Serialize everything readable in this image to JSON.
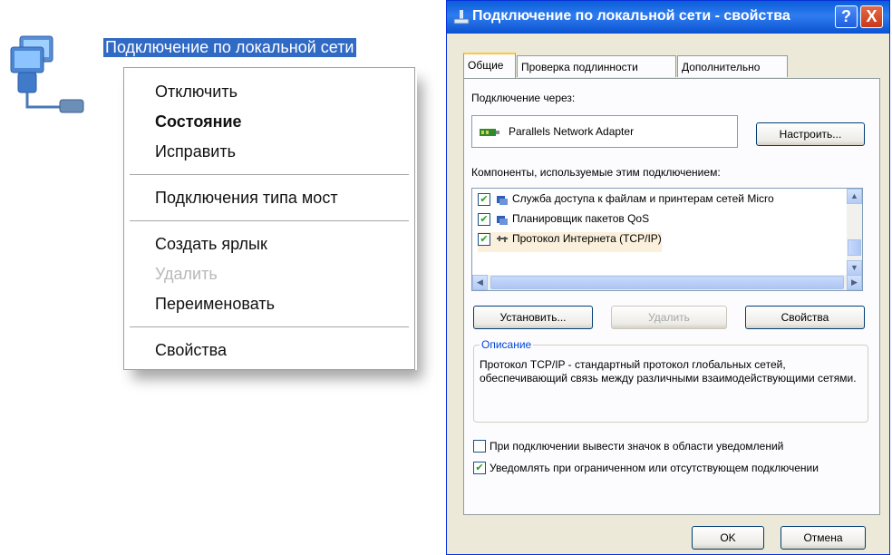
{
  "desktop": {
    "icon_label": "Подключение по локальной сети"
  },
  "context_menu": {
    "items": [
      {
        "label": "Отключить",
        "bold": false,
        "disabled": false
      },
      {
        "label": "Состояние",
        "bold": true,
        "disabled": false
      },
      {
        "label": "Исправить",
        "bold": false,
        "disabled": false
      },
      {
        "label": "Подключения типа мост",
        "bold": false,
        "disabled": false
      },
      {
        "label": "Создать ярлык",
        "bold": false,
        "disabled": false
      },
      {
        "label": "Удалить",
        "bold": false,
        "disabled": true
      },
      {
        "label": "Переименовать",
        "bold": false,
        "disabled": false
      },
      {
        "label": "Свойства",
        "bold": false,
        "disabled": false
      }
    ]
  },
  "dialog": {
    "title": "Подключение по локальной сети - свойства",
    "help_label": "?",
    "close_label": "X",
    "tabs": [
      {
        "label": "Общие",
        "active": true
      },
      {
        "label": "Проверка подлинности",
        "active": false
      },
      {
        "label": "Дополнительно",
        "active": false
      }
    ],
    "connect_using_label": "Подключение через:",
    "adapter_name": "Parallels Network Adapter",
    "configure_button": "Настроить...",
    "components_label": "Компоненты, используемые этим подключением:",
    "components": [
      {
        "label": "Служба доступа к файлам и принтерам сетей Micro",
        "checked": true,
        "selected": false,
        "icon": "service-icon"
      },
      {
        "label": "Планировщик пакетов QoS",
        "checked": true,
        "selected": false,
        "icon": "service-icon"
      },
      {
        "label": "Протокол Интернета (TCP/IP)",
        "checked": true,
        "selected": true,
        "icon": "protocol-icon"
      }
    ],
    "install_button": "Установить...",
    "remove_button": "Удалить",
    "properties_button": "Свойства",
    "description_title": "Описание",
    "description_text": "Протокол TCP/IP - стандартный протокол глобальных сетей, обеспечивающий связь между различными взаимодействующими сетями.",
    "show_icon_option": {
      "label": "При подключении вывести значок в области уведомлений",
      "checked": false
    },
    "notify_option": {
      "label": "Уведомлять при ограниченном или отсутствующем подключении",
      "checked": true
    },
    "ok_button": "OK",
    "cancel_button": "Отмена"
  }
}
